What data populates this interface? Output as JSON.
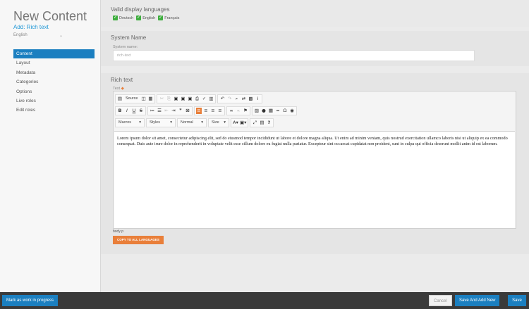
{
  "sidebar": {
    "title": "New Content",
    "subtitle": "Add: Rich text",
    "language": "English",
    "nav": [
      {
        "label": "Content",
        "active": true
      },
      {
        "label": "Layout"
      },
      {
        "label": "Metadata"
      },
      {
        "label": "Categories"
      },
      {
        "label": "Options"
      },
      {
        "label": "Live roles"
      },
      {
        "label": "Edit roles"
      }
    ]
  },
  "valid_languages": {
    "title": "Valid display languages",
    "items": [
      "Deutsch",
      "English",
      "Français"
    ]
  },
  "system_name": {
    "title": "System Name",
    "label": "System name:",
    "value": "rich-text"
  },
  "rich_text": {
    "title": "Rich text",
    "label": "Text",
    "toolbar": {
      "source_label": "Source",
      "macros": "Macros",
      "styles": "Styles",
      "format": "Normal",
      "size": "Size"
    },
    "content": "Lorem ipsum dolor sit amet, consectetur adipiscing elit, sed do eiusmod tempor incididunt ut labore et dolore magna aliqua. Ut enim ad minim veniam, quis nostrud exercitation ullamco laboris nisi ut aliquip ex ea commodo consequat. Duis aute irure dolor in reprehenderit in voluptate velit esse cillum dolore eu fugiat nulla pariatur. Excepteur sint occaecat cupidatat non proident, sunt in culpa qui officia deserunt mollit anim id est laborum.",
    "path": "body  p",
    "copy_button": "COPY TO ALL LANGUAGES"
  },
  "footer": {
    "wip": "Mark as work in progress",
    "cancel": "Cancel",
    "save_add": "Save And Add New",
    "save": "Save"
  },
  "colors": {
    "accent": "#1b7fc0",
    "orange": "#e97f3a",
    "check": "#3fae3f"
  }
}
